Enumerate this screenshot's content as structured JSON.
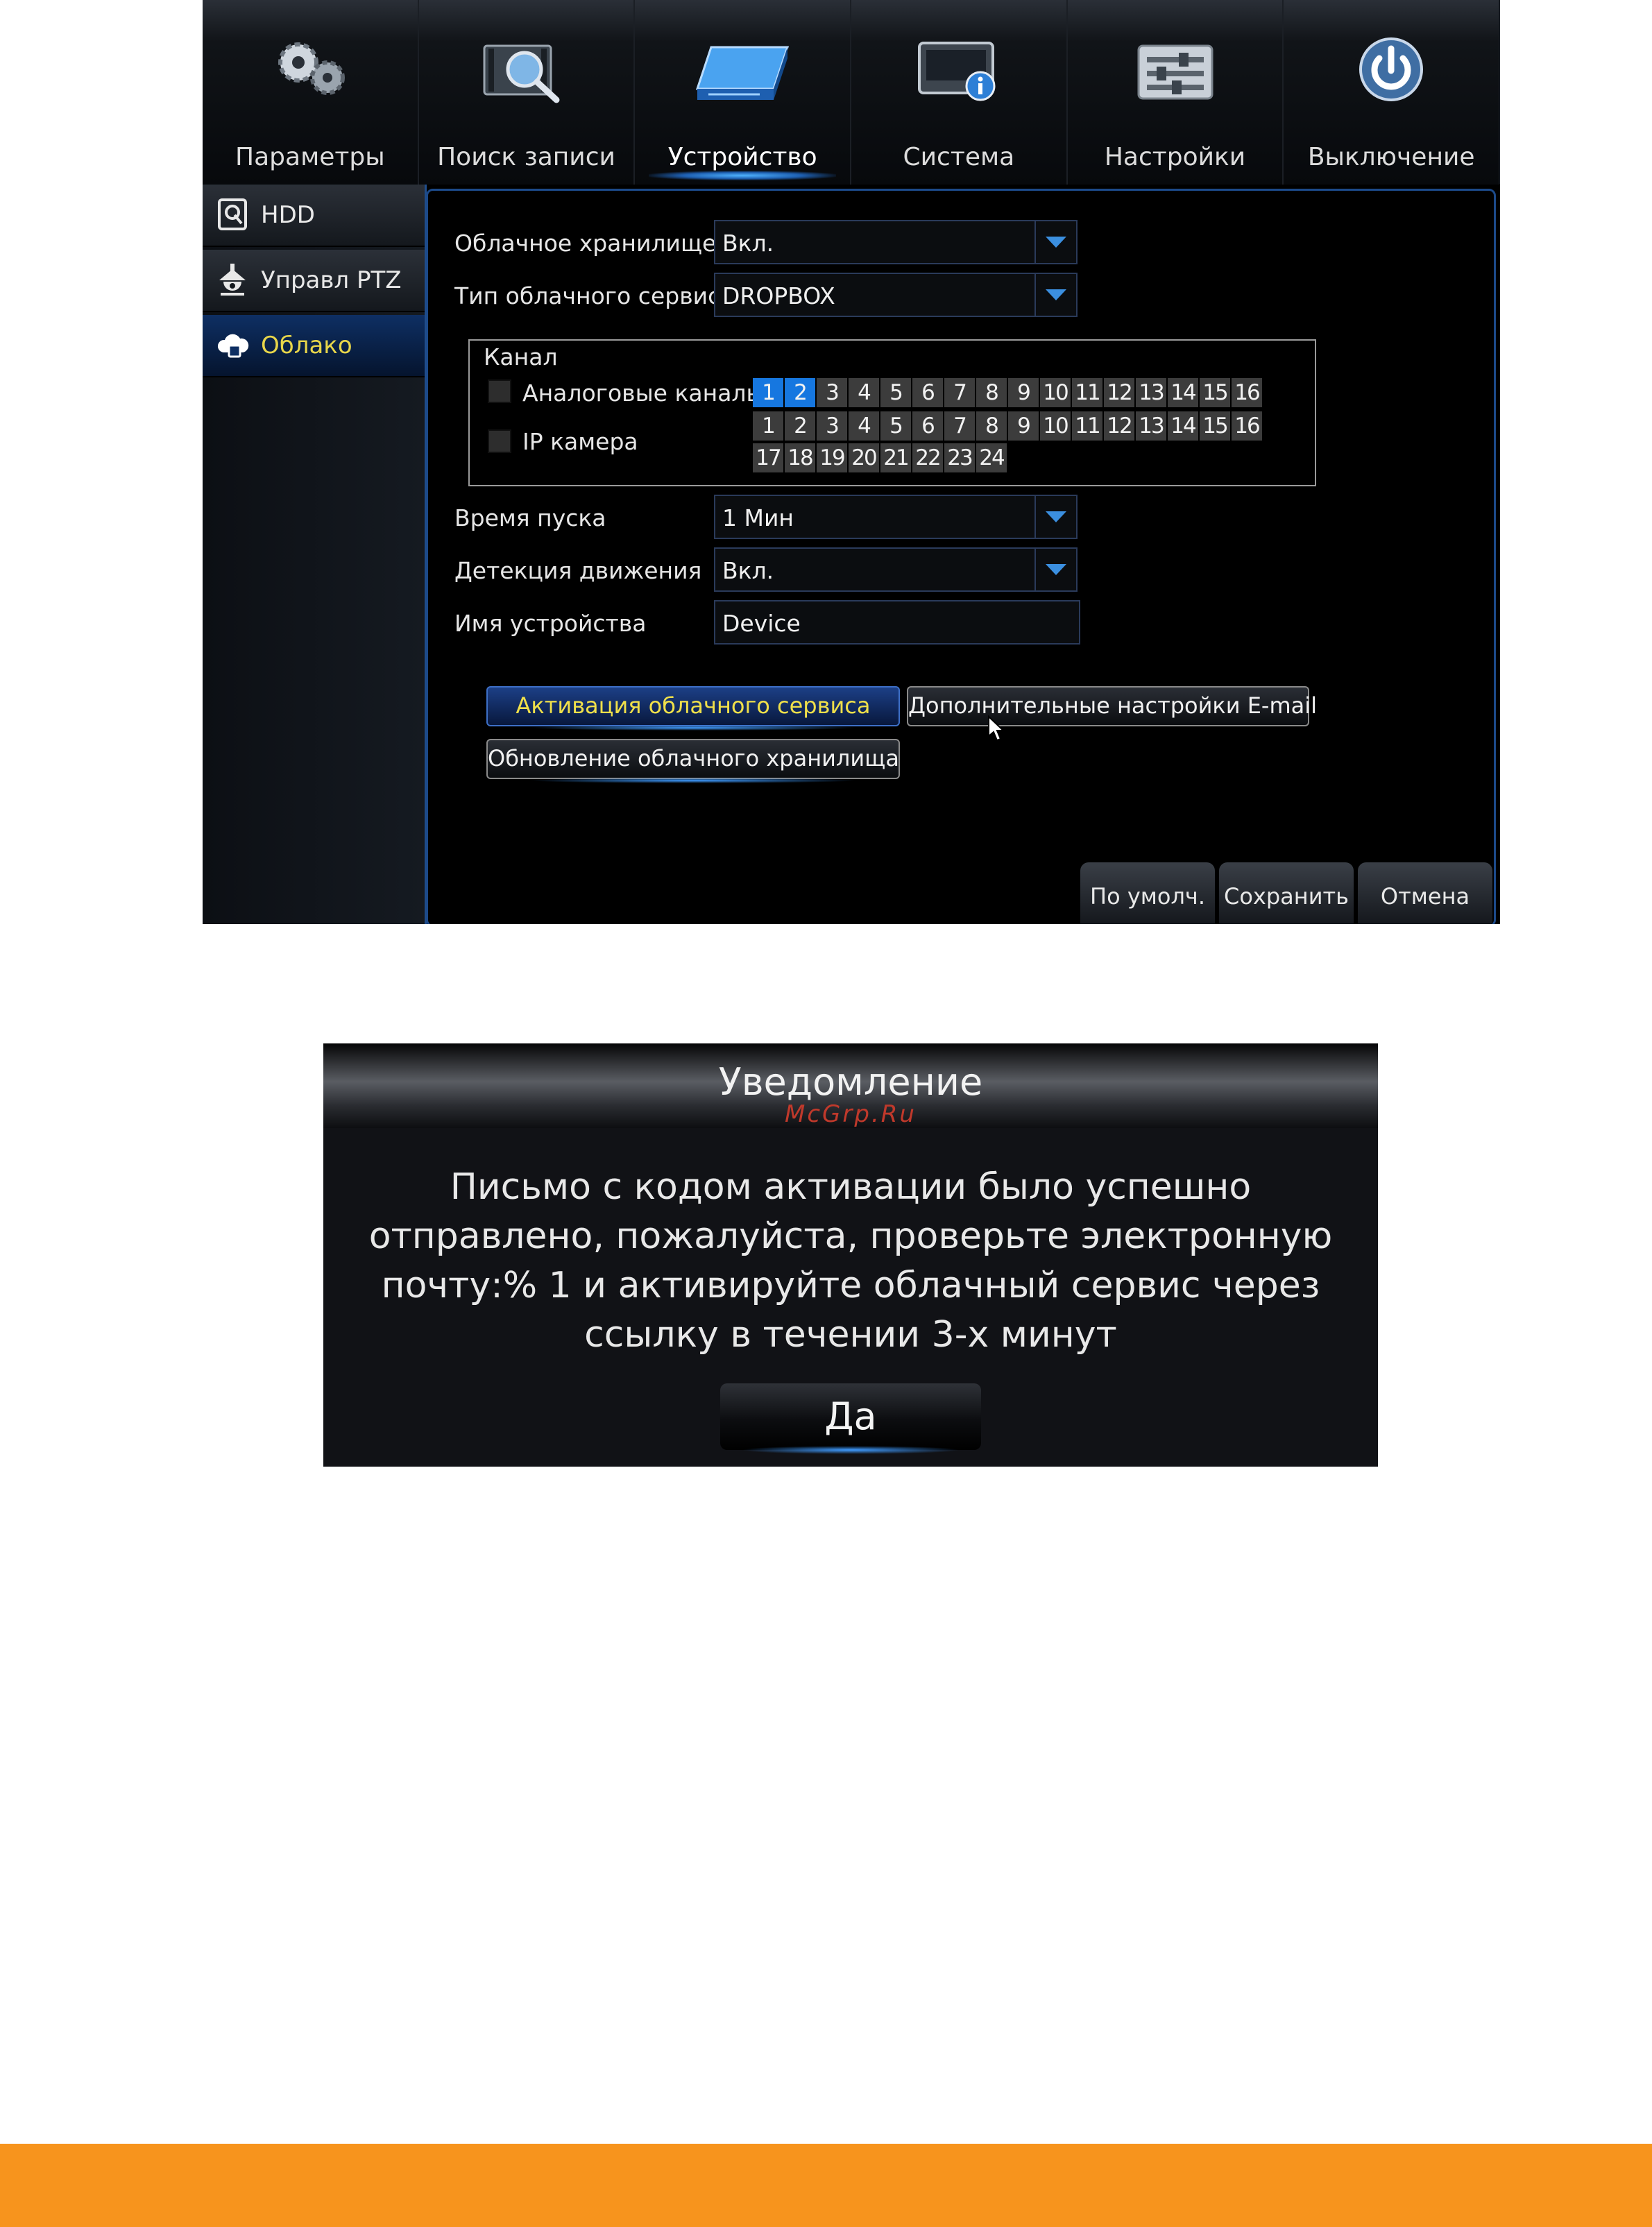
{
  "top_tabs": [
    {
      "label": "Параметры",
      "icon": "gears-icon"
    },
    {
      "label": "Поиск записи",
      "icon": "film-search-icon"
    },
    {
      "label": "Устройство",
      "icon": "hdd-device-icon",
      "active": true
    },
    {
      "label": "Система",
      "icon": "monitor-info-icon"
    },
    {
      "label": "Настройки",
      "icon": "sliders-icon"
    },
    {
      "label": "Выключение",
      "icon": "power-icon"
    }
  ],
  "sidebar": {
    "items": [
      {
        "label": "HDD",
        "icon": "hdd-icon"
      },
      {
        "label": "Управл PTZ",
        "icon": "ptz-camera-icon"
      },
      {
        "label": "Облако",
        "icon": "cloud-icon",
        "active": true
      }
    ]
  },
  "form": {
    "cloud_storage": {
      "label": "Облачное хранилище",
      "value": "Вкл."
    },
    "cloud_service_type": {
      "label": "Тип облачного сервиса",
      "value": "DROPBOX"
    },
    "channel": {
      "legend": "Канал",
      "analog_label": "Аналоговые каналы",
      "ip_label": "IP камера",
      "analog_channels": [
        "1",
        "2",
        "3",
        "4",
        "5",
        "6",
        "7",
        "8",
        "9",
        "10",
        "11",
        "12",
        "13",
        "14",
        "15",
        "16"
      ],
      "analog_selected": [
        "1",
        "2"
      ],
      "ip_channels_row1": [
        "1",
        "2",
        "3",
        "4",
        "5",
        "6",
        "7",
        "8",
        "9",
        "10",
        "11",
        "12",
        "13",
        "14",
        "15",
        "16"
      ],
      "ip_channels_row2": [
        "17",
        "18",
        "19",
        "20",
        "21",
        "22",
        "23",
        "24"
      ]
    },
    "start_time": {
      "label": "Время пуска",
      "value": "1 Мин"
    },
    "motion_detection": {
      "label": "Детекция движения",
      "value": "Вкл."
    },
    "device_name": {
      "label": "Имя устройства",
      "value": "Device"
    }
  },
  "buttons": {
    "activate_cloud": "Активация облачного сервиса",
    "email_settings": "Дополнительные настройки E-mail",
    "update_cloud": "Обновление облачного хранилища",
    "default": "По умолч.",
    "save": "Сохранить",
    "cancel": "Отмена"
  },
  "dialog": {
    "title": "Уведомление",
    "watermark": "McGrp.Ru",
    "message": "Письмо с кодом активации было успешно отправлено, пожалуйста, проверьте электронную почту:% 1 и активируйте облачный сервис через ссылку в течении 3-х минут",
    "ok_label": "Да"
  },
  "colors": {
    "accent_blue": "#1677e0",
    "active_text_yellow": "#e8d64a",
    "footer_orange": "#f7941d"
  }
}
